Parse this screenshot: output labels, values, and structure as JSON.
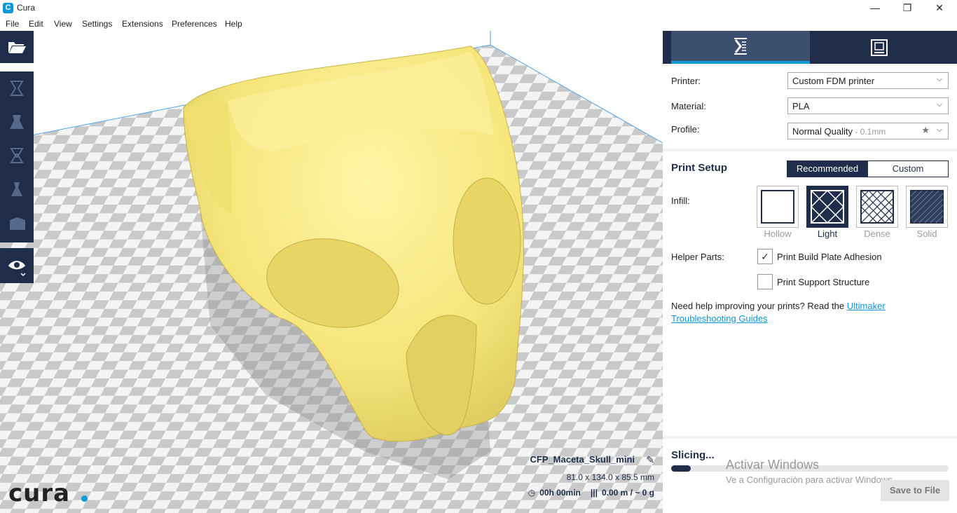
{
  "window": {
    "title": "Cura",
    "app_icon_glyph": "C",
    "controls": {
      "minimize": "—",
      "maximize": "❐",
      "close": "✕"
    }
  },
  "menu": [
    "File",
    "Edit",
    "View",
    "Settings",
    "Extensions",
    "Preferences",
    "Help"
  ],
  "toolbar": {
    "tools": [
      "open-folder-icon",
      "translate-icon",
      "scale-icon",
      "rotate-icon",
      "mirror-icon",
      "per-model-settings-icon",
      "view-mode-eye-icon"
    ]
  },
  "viewport": {
    "logo": "cura",
    "object": {
      "name": "CFP_Maceta_Skull_mini",
      "dimensions": "81.0 x 134.0 x 85.5 mm",
      "print_time": "00h 00min",
      "material_usage": "0.00 m / ~ 0 g"
    },
    "model_color": "#f5e57a"
  },
  "panel": {
    "printer_label": "Printer:",
    "printer_value": "Custom FDM printer",
    "material_label": "Material:",
    "material_value": "PLA",
    "profile_label": "Profile:",
    "profile_value": "Normal Quality",
    "profile_suffix": " - 0.1mm",
    "print_setup_title": "Print Setup",
    "mode_recommended": "Recommended",
    "mode_custom": "Custom",
    "infill_label": "Infill:",
    "infill_options": [
      "Hollow",
      "Light",
      "Dense",
      "Solid"
    ],
    "infill_selected": "Light",
    "helper_label": "Helper Parts:",
    "adhesion_label": "Print Build Plate Adhesion",
    "adhesion_checked": true,
    "support_label": "Print Support Structure",
    "support_checked": false,
    "help_text": "Need help improving your prints? Read the ",
    "help_link": "Ultimaker Troubleshooting Guides",
    "slicing_title": "Slicing...",
    "slicing_progress": 0.07,
    "save_button": "Save to File",
    "watermark_title": "Activar Windows",
    "watermark_sub": "Ve a Configuración para activar Windows."
  },
  "colors": {
    "accent": "#0d98d6",
    "navy": "#1f2d4a"
  }
}
